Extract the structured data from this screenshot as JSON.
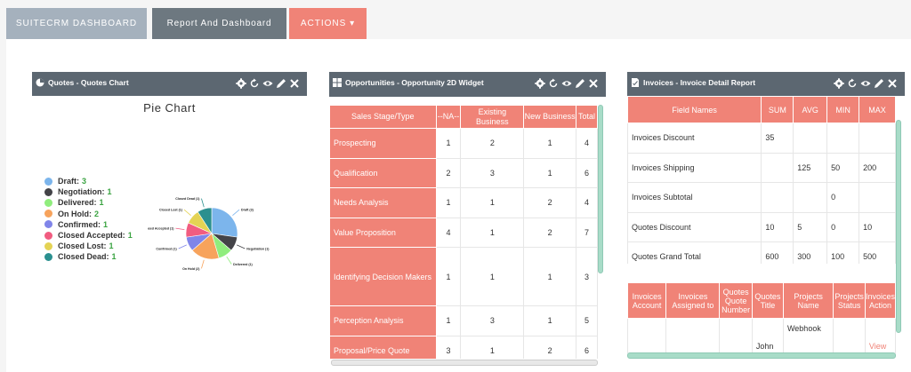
{
  "tabs": {
    "suite": "SUITECRM DASHBOARD",
    "report": "Report And Dashboard",
    "actions": "ACTIONS ▾"
  },
  "dashlet_quotes": {
    "title": "Quotes - Quotes Chart",
    "chart_title": "Pie Chart",
    "legend": [
      {
        "label": "Draft:",
        "value": "3",
        "color": "#7cb5ec"
      },
      {
        "label": "Negotiation:",
        "value": "1",
        "color": "#434348"
      },
      {
        "label": "Delivered:",
        "value": "1",
        "color": "#90ed7d"
      },
      {
        "label": "On Hold:",
        "value": "2",
        "color": "#f7a35c"
      },
      {
        "label": "Confirmed:",
        "value": "1",
        "color": "#8085e9"
      },
      {
        "label": "Closed Accepted:",
        "value": "1",
        "color": "#f15c80"
      },
      {
        "label": "Closed Lost:",
        "value": "1",
        "color": "#e4d354"
      },
      {
        "label": "Closed Dead:",
        "value": "1",
        "color": "#2b908f"
      }
    ],
    "slice_labels": [
      "Draft (3)",
      "Negotiation (1)",
      "Delivered (1)",
      "On Hold (2)",
      "Confirmed (1)",
      "Closed Accepted (1)",
      "Closed Lost (1)",
      "Closed Dead (1)"
    ]
  },
  "chart_data": {
    "type": "pie",
    "title": "Pie Chart",
    "categories": [
      "Draft",
      "Negotiation",
      "Delivered",
      "On Hold",
      "Confirmed",
      "Closed Accepted",
      "Closed Lost",
      "Closed Dead"
    ],
    "values": [
      3,
      1,
      1,
      2,
      1,
      1,
      1,
      1
    ],
    "colors": [
      "#7cb5ec",
      "#434348",
      "#90ed7d",
      "#f7a35c",
      "#8085e9",
      "#f15c80",
      "#e4d354",
      "#2b908f"
    ],
    "legend": "left"
  },
  "dashlet_opps": {
    "title": "Opportunities - Opportunity 2D Widget",
    "headers": [
      "Sales Stage/Type",
      "--NA--",
      "Existing Business",
      "New Business",
      "Total"
    ],
    "rows": [
      {
        "stage": "Prospecting",
        "na": "1",
        "existing": "2",
        "new": "1",
        "total": "4"
      },
      {
        "stage": "Qualification",
        "na": "2",
        "existing": "3",
        "new": "1",
        "total": "6"
      },
      {
        "stage": "Needs Analysis",
        "na": "1",
        "existing": "1",
        "new": "2",
        "total": "4"
      },
      {
        "stage": "Value Proposition",
        "na": "4",
        "existing": "1",
        "new": "2",
        "total": "7"
      },
      {
        "stage": "Identifying Decision Makers",
        "na": "1",
        "existing": "1",
        "new": "1",
        "total": "3"
      },
      {
        "stage": "Perception Analysis",
        "na": "1",
        "existing": "3",
        "new": "1",
        "total": "5"
      },
      {
        "stage": "Proposal/Price Quote",
        "na": "3",
        "existing": "1",
        "new": "2",
        "total": "6"
      }
    ]
  },
  "dashlet_invoices": {
    "title": "Invoices - Invoice Detail Report",
    "headers": [
      "Field Names",
      "SUM",
      "AVG",
      "MIN",
      "MAX"
    ],
    "rows": [
      {
        "name": "Invoices Discount",
        "sum": "35",
        "avg": "",
        "min": "",
        "max": ""
      },
      {
        "name": "Invoices Shipping",
        "sum": "",
        "avg": "125",
        "min": "50",
        "max": "200"
      },
      {
        "name": "Invoices Subtotal",
        "sum": "",
        "avg": "",
        "min": "0",
        "max": ""
      },
      {
        "name": "Quotes Discount",
        "sum": "10",
        "avg": "5",
        "min": "0",
        "max": "10"
      },
      {
        "name": "Quotes Grand Total",
        "sum": "600",
        "avg": "300",
        "min": "100",
        "max": "500"
      }
    ],
    "detail_headers": [
      "Invoices Account",
      "Invoices Assigned to",
      "Quotes Quote Number",
      "Quotes Title",
      "Projects Name",
      "Projects Status",
      "Invoices Action"
    ],
    "detail_row": [
      "",
      "",
      "",
      "John",
      "Webhook",
      "",
      "View"
    ]
  }
}
